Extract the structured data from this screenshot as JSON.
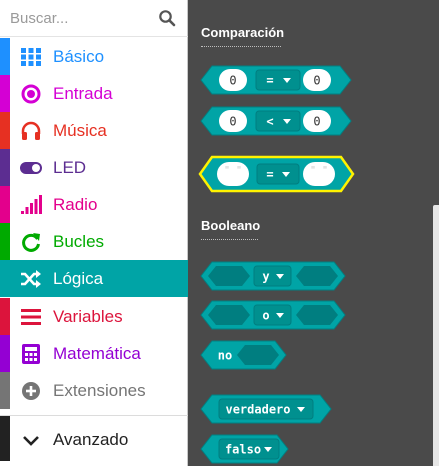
{
  "search": {
    "placeholder": "Buscar..."
  },
  "categories": [
    {
      "label": "Básico",
      "color": "#1E90FF",
      "icon": "grid-icon"
    },
    {
      "label": "Entrada",
      "color": "#D400D4",
      "icon": "input-circle-icon"
    },
    {
      "label": "Música",
      "color": "#E63022",
      "icon": "headphones-icon"
    },
    {
      "label": "LED",
      "color": "#5C2D91",
      "icon": "toggle-icon"
    },
    {
      "label": "Radio",
      "color": "#E3008C",
      "icon": "signal-bars-icon"
    },
    {
      "label": "Bucles",
      "color": "#00AA00",
      "icon": "refresh-icon"
    },
    {
      "label": "Lógica",
      "color": "#00A4A6",
      "icon": "shuffle-icon",
      "selected": true
    },
    {
      "label": "Variables",
      "color": "#DC143C",
      "icon": "list-lines-icon"
    },
    {
      "label": "Matemática",
      "color": "#9400D3",
      "icon": "calculator-icon"
    },
    {
      "label": "Extensiones",
      "color": "#757575",
      "icon": "plus-circle-icon"
    }
  ],
  "advanced": {
    "label": "Avanzado",
    "color": "#222222",
    "icon": "chevron-down-icon"
  },
  "workspace": {
    "sections": {
      "comparison": "Comparación",
      "boolean": "Booleano"
    },
    "blocks": {
      "compare_eq": {
        "left": "0",
        "op": "=",
        "right": "0"
      },
      "compare_lt": {
        "left": "0",
        "op": "<",
        "right": "0"
      },
      "compare_str": {
        "left": "\" \"",
        "op": "=",
        "right": "\" \""
      },
      "and": {
        "op": "y"
      },
      "or": {
        "op": "o"
      },
      "not": {
        "label": "no"
      },
      "true": {
        "label": "verdadero"
      },
      "false": {
        "label": "falso"
      }
    },
    "colors": {
      "block": "#00A4A6",
      "block_stroke": "#008082",
      "slot": "#007E80",
      "dropdown": "#00908F",
      "highlight": "#FFF200",
      "background": "#4A4A4A"
    }
  }
}
